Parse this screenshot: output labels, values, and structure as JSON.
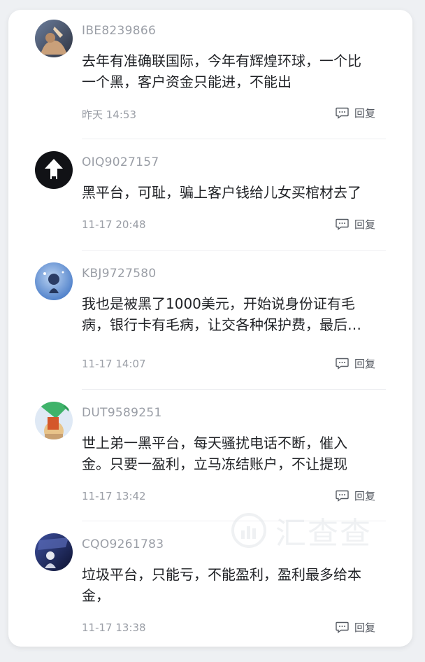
{
  "comments": [
    {
      "user": "IBE8239866",
      "lines": [
        "去年有准确联国际，今年有辉煌环球，一个比",
        "一个黑，客户资金只能进，不能出"
      ],
      "time": "昨天 14:53",
      "reply_label": "回复"
    },
    {
      "user": "OIQ9027157",
      "lines": [
        "黑平台，可耻，骗上客户钱给儿女买棺材去了"
      ],
      "time": "11-17 20:48",
      "reply_label": "回复"
    },
    {
      "user": "KBJ9727580",
      "lines": [
        "我也是被黑了1000美元，开始说身份证有毛",
        "病，银行卡有毛病，让交各种保护费，最后…"
      ],
      "time": "11-17 14:07",
      "reply_label": "回复"
    },
    {
      "user": "DUT9589251",
      "lines": [
        "世上弟一黑平台，每天骚扰电话不断，催入",
        "金。只要一盈利，立马冻结账户，不让提现"
      ],
      "time": "11-17 13:42",
      "reply_label": "回复"
    },
    {
      "user": "CQO9261783",
      "lines": [
        "垃圾平台，只能亏，不能盈利，盈利最多给本",
        "金，"
      ],
      "time": "11-17 13:38",
      "reply_label": "回复"
    }
  ],
  "watermark": "汇查查",
  "icons": {
    "reply": "comment-bubble-icon",
    "watermark": "chart-logo-icon"
  },
  "colors": {
    "text": "#1f2125",
    "muted": "#9a9ea6",
    "background": "#eef0f3"
  }
}
